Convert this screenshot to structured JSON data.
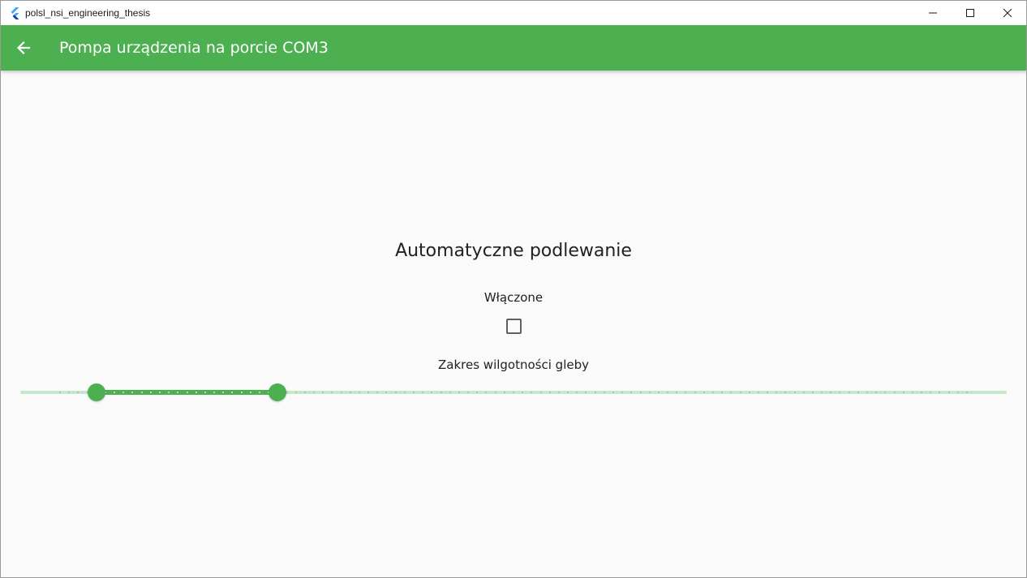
{
  "window": {
    "title": "polsl_nsi_engineering_thesis",
    "controls": {
      "minimize_icon": "minimize-icon",
      "maximize_icon": "maximize-icon",
      "close_icon": "close-icon"
    }
  },
  "appbar": {
    "title": "Pompa urządzenia na porcie COM3",
    "back_icon": "arrow-back-icon",
    "color": "#4caf50"
  },
  "auto_watering": {
    "title": "Automatyczne podlewanie",
    "enabled_label": "Włączone",
    "enabled": false,
    "range_label": "Zakres wilgotności gleby",
    "range": {
      "min": 0,
      "max": 100,
      "divisions": 100,
      "start": 4,
      "end": 24
    }
  },
  "colors": {
    "primary": "#4caf50",
    "track_inactive": "#c8e6c9",
    "background": "#fafafa"
  }
}
